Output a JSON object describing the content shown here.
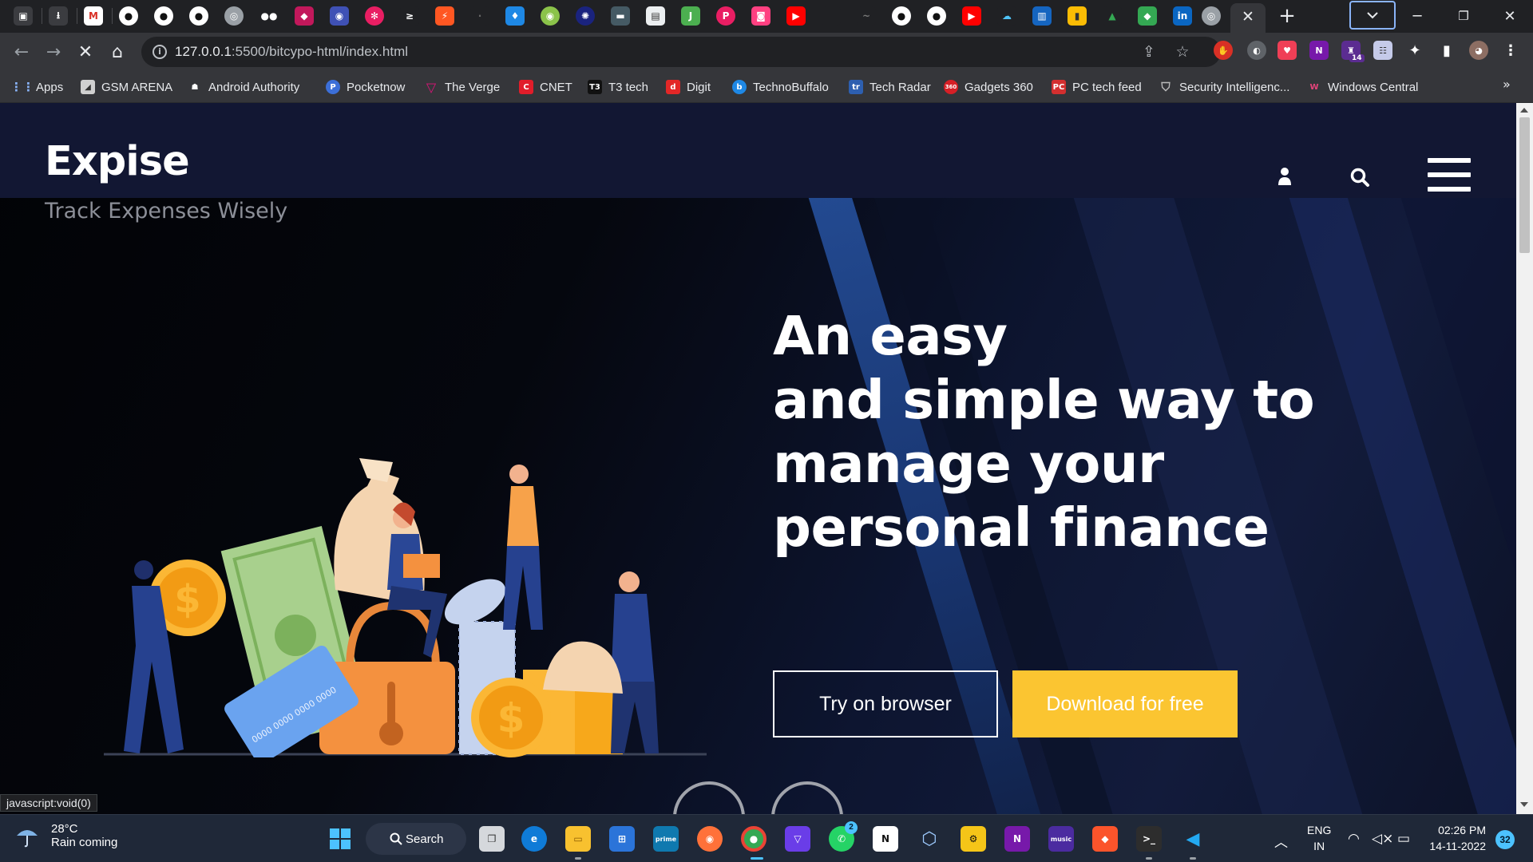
{
  "browser": {
    "url_host": "127.0.0.1",
    "url_path": ":5500/bitcypo-html/index.html",
    "status_url": "javascript:void(0)",
    "extension_badge": "14"
  },
  "bookmarks": [
    {
      "label": "Apps",
      "icon": "apps-grid-icon",
      "color": "#4285f4"
    },
    {
      "label": "GSM ARENA",
      "icon": "gsmarena-icon",
      "color": "#d0d0d0"
    },
    {
      "label": "Android Authority",
      "icon": "android-authority-icon",
      "color": "#3ddc84"
    },
    {
      "label": "Pocketnow",
      "icon": "pocketnow-icon",
      "color": "#3c6fd8"
    },
    {
      "label": "The Verge",
      "icon": "the-verge-icon",
      "color": "#e2127a"
    },
    {
      "label": "CNET",
      "icon": "cnet-icon",
      "color": "#e11d2a"
    },
    {
      "label": "T3 tech",
      "icon": "t3-icon",
      "color": "#111111"
    },
    {
      "label": "Digit",
      "icon": "digit-icon",
      "color": "#e32727"
    },
    {
      "label": "TechnoBuffalo",
      "icon": "technobuffalo-icon",
      "color": "#1e88e5"
    },
    {
      "label": "Tech Radar",
      "icon": "techradar-icon",
      "color": "#2d5fb0"
    },
    {
      "label": "Gadgets 360",
      "icon": "gadgets360-icon",
      "color": "#d61f26"
    },
    {
      "label": "PC tech feed",
      "icon": "pc-icon",
      "color": "#d32f2f"
    },
    {
      "label": "Security Intelligenc...",
      "icon": "shield-icon",
      "color": "#444444"
    },
    {
      "label": "Windows Central",
      "icon": "windows-central-icon",
      "color": "#e6447b"
    }
  ],
  "site": {
    "brand": "Expise",
    "tagline": "Track Expenses Wisely",
    "hero_lines": [
      "An easy",
      "and simple way to",
      "manage your",
      "personal finance"
    ],
    "try_button": "Try on browser",
    "download_button": "Download for free",
    "card_number": "0000 0000 0000 0000",
    "accent_color": "#fbc531",
    "header_color": "#121733"
  },
  "taskbar": {
    "weather_temp": "28°C",
    "weather_desc": "Rain coming",
    "search_label": "Search",
    "lang_top": "ENG",
    "lang_bottom": "IN",
    "time": "02:26 PM",
    "date": "14-11-2022",
    "notification_count": "32",
    "whatsapp_badge": "2"
  }
}
